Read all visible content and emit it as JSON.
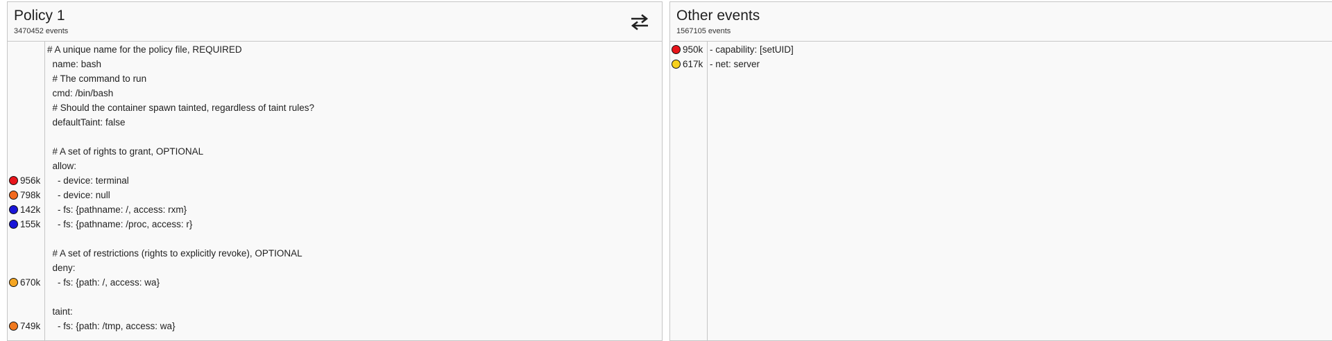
{
  "left_panel": {
    "title": "Policy 1",
    "subtitle": "3470452 events",
    "swap_icon": "swap-horiz-icon",
    "lines": [
      {
        "code": "# A unique name for the policy file, REQUIRED",
        "count": "",
        "color": ""
      },
      {
        "code": "  name: bash",
        "count": "",
        "color": ""
      },
      {
        "code": "  # The command to run",
        "count": "",
        "color": ""
      },
      {
        "code": "  cmd: /bin/bash",
        "count": "",
        "color": ""
      },
      {
        "code": "  # Should the container spawn tainted, regardless of taint rules?",
        "count": "",
        "color": ""
      },
      {
        "code": "  defaultTaint: false",
        "count": "",
        "color": ""
      },
      {
        "code": "",
        "count": "",
        "color": ""
      },
      {
        "code": "  # A set of rights to grant, OPTIONAL",
        "count": "",
        "color": ""
      },
      {
        "code": "  allow:",
        "count": "",
        "color": ""
      },
      {
        "code": "    - device: terminal",
        "count": "956k",
        "color": "#e8151b"
      },
      {
        "code": "    - device: null",
        "count": "798k",
        "color": "#f26a1f"
      },
      {
        "code": "    - fs: {pathname: /, access: rxm}",
        "count": "142k",
        "color": "#1a16d8"
      },
      {
        "code": "    - fs: {pathname: /proc, access: r}",
        "count": "155k",
        "color": "#1a16d8"
      },
      {
        "code": "",
        "count": "",
        "color": ""
      },
      {
        "code": "  # A set of restrictions (rights to explicitly revoke), OPTIONAL",
        "count": "",
        "color": ""
      },
      {
        "code": "  deny:",
        "count": "",
        "color": ""
      },
      {
        "code": "    - fs: {path: /, access: wa}",
        "count": "670k",
        "color": "#f5a623"
      },
      {
        "code": "",
        "count": "",
        "color": ""
      },
      {
        "code": "  taint:",
        "count": "",
        "color": ""
      },
      {
        "code": "    - fs: {path: /tmp, access: wa}",
        "count": "749k",
        "color": "#f0791f"
      }
    ]
  },
  "right_panel": {
    "title": "Other events",
    "subtitle": "1567105 events",
    "lines": [
      {
        "code": "- capability: [setUID]",
        "count": "950k",
        "color": "#e8151b"
      },
      {
        "code": "- net: server",
        "count": "617k",
        "color": "#f7d11e"
      }
    ]
  }
}
